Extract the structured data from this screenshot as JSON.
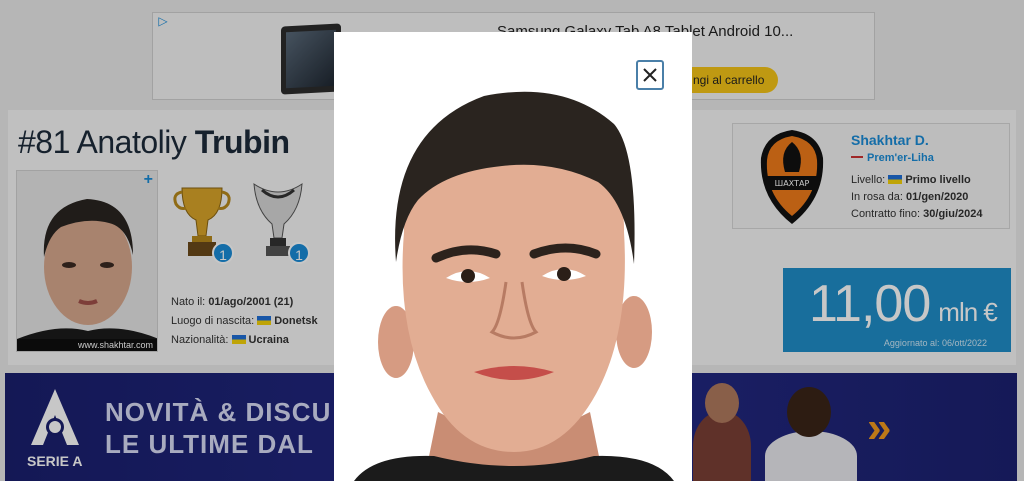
{
  "ad": {
    "badge_icon": "adchoices-icon",
    "title": "Samsung Galaxy Tab A8 Tablet Android 10...",
    "cta": "ngi al carrello"
  },
  "player": {
    "number": "#81",
    "first_name": "Anatoliy",
    "last_name": "Trubin",
    "photo_credit": "www.shakhtar.com",
    "trophies": [
      {
        "icon": "league-cup-trophy-icon",
        "count": "1"
      },
      {
        "icon": "super-cup-trophy-icon",
        "count": "1"
      }
    ],
    "bio": {
      "born_label": "Nato il:",
      "born_value": "01/ago/2001 (21)",
      "birthplace_label": "Luogo di nascita:",
      "birthplace_value": "Donetsk",
      "nationality_label": "Nazionalità:",
      "nationality_value": "Ucraina"
    }
  },
  "club": {
    "name": "Shakhtar D.",
    "league": "Prem'er-Liha",
    "level_label": "Livello:",
    "level_value": "Primo livello",
    "joined_label": "In rosa da:",
    "joined_value": "01/gen/2020",
    "contract_label": "Contratto fino:",
    "contract_value": "30/giu/2024",
    "logo_text": "ШАХТАР"
  },
  "market_value": {
    "amount": "11,00",
    "unit": "mln €",
    "updated": "Aggiornato al: 06/ott/2022"
  },
  "banner": {
    "brand": "SERIE A",
    "line1": "NOVITÀ & DISCU",
    "line2": "LE ULTIME DAL",
    "arrows": "»",
    "colors": {
      "bg": "#1a1f6e",
      "accent": "#f39a1e"
    }
  },
  "modal": {
    "close_icon": "close-icon"
  }
}
